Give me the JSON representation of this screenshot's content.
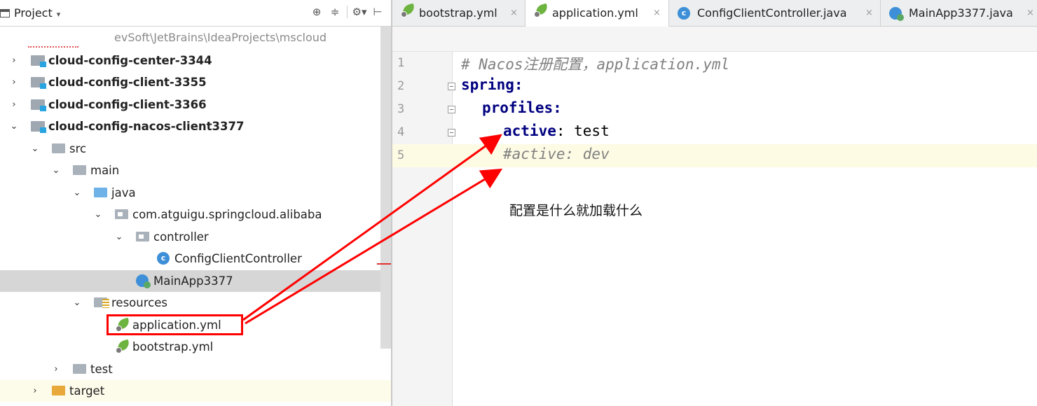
{
  "project_panel": {
    "title": "Project",
    "caret": "▾",
    "header_icons": [
      "⊕",
      "≑",
      "⚙▾",
      "⊢"
    ],
    "path": "evSoft\\JetBrains\\IdeaProjects\\mscloud",
    "tree": [
      {
        "label": "cloud-config-center-3344",
        "chevron": "›",
        "icon": "module-icon"
      },
      {
        "label": "cloud-config-client-3355",
        "chevron": "›",
        "icon": "module-icon"
      },
      {
        "label": "cloud-config-client-3366",
        "chevron": "›",
        "icon": "module-icon"
      },
      {
        "label": "cloud-config-nacos-client3377",
        "chevron": "⌄",
        "icon": "module-icon"
      },
      {
        "label": "src",
        "chevron": "⌄",
        "icon": "folder-icon"
      },
      {
        "label": "main",
        "chevron": "⌄",
        "icon": "folder-icon"
      },
      {
        "label": "java",
        "chevron": "⌄",
        "icon": "source-folder-icon"
      },
      {
        "label": "com.atguigu.springcloud.alibaba",
        "chevron": "⌄",
        "icon": "package-icon"
      },
      {
        "label": "controller",
        "chevron": "⌄",
        "icon": "package-icon"
      },
      {
        "label": "ConfigClientController",
        "chevron": "",
        "icon": "class-icon",
        "icon_letter": "c"
      },
      {
        "label": "MainApp3377",
        "chevron": "",
        "icon": "main-class-icon"
      },
      {
        "label": "resources",
        "chevron": "⌄",
        "icon": "resources-folder-icon"
      },
      {
        "label": "application.yml",
        "chevron": "",
        "icon": "spring-yml-icon"
      },
      {
        "label": "bootstrap.yml",
        "chevron": "",
        "icon": "spring-yml-icon"
      },
      {
        "label": "test",
        "chevron": "›",
        "icon": "folder-icon"
      },
      {
        "label": "target",
        "chevron": "›",
        "icon": "excluded-folder-icon"
      }
    ]
  },
  "tabs": [
    {
      "label": "bootstrap.yml",
      "close": "×",
      "icon": "spring-yml-icon"
    },
    {
      "label": "application.yml",
      "close": "×",
      "icon": "spring-yml-icon",
      "active": true
    },
    {
      "label": "ConfigClientController.java",
      "close": "×",
      "icon": "class-icon",
      "icon_letter": "c"
    },
    {
      "label": "MainApp3377.java",
      "close": "×",
      "icon": "main-class-icon"
    }
  ],
  "editor": {
    "line_numbers": [
      "1",
      "2",
      "3",
      "4",
      "5"
    ],
    "lines": {
      "l1_comment": "# Nacos注册配置，application.yml",
      "l2_key": "spring",
      "l2_colon": ":",
      "l3_key": "profiles",
      "l3_colon": ":",
      "l4_key": "active",
      "l4_rest": ": test",
      "l5_comment": "#active: dev"
    },
    "annotation": "配置是什么就加载什么"
  },
  "colors": {
    "arrow": "#ff0000",
    "keyword": "#000080",
    "comment": "#808080",
    "selection": "#d6d6d6"
  }
}
